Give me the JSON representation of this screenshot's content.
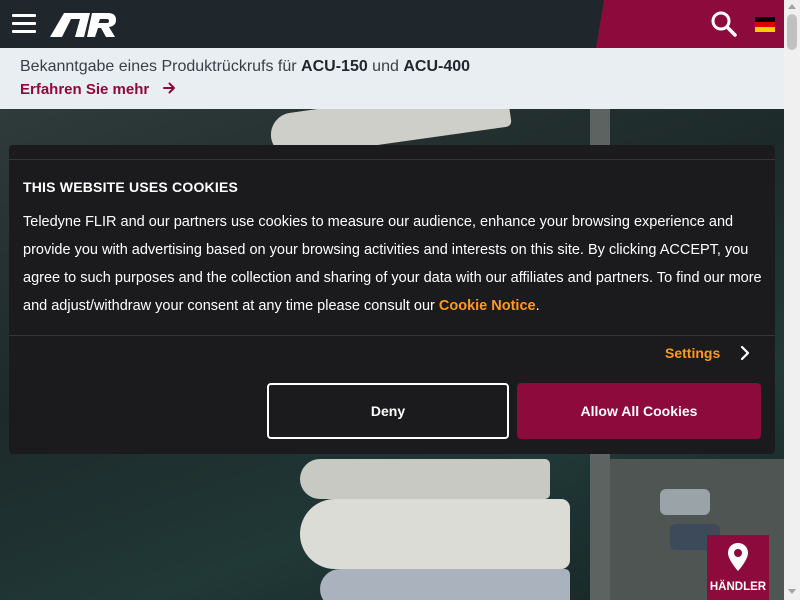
{
  "header": {
    "menu_icon": "hamburger-icon",
    "logo_icon": "brand-logo",
    "search_icon": "search-icon",
    "language_icon": "german-flag-icon",
    "colors": {
      "bar": "#1f262c",
      "accent": "#8c0a3c"
    }
  },
  "announcement": {
    "prefix": "Bekanntgabe eines Produktrückrufs für ",
    "product1": "ACU-150",
    "connector": " und ",
    "product2": "ACU-400",
    "link_label": "Erfahren Sie mehr",
    "link_icon": "arrow-right-icon"
  },
  "cookie": {
    "title": "THIS WEBSITE USES COOKIES",
    "body": "Teledyne FLIR and our partners use cookies to measure our audience, enhance your browsing experience and provide you with advertising based on your browsing activities and interests on this site. By clicking ACCEPT, you agree to such purposes and the collection and sharing of your data with our affiliates and partners. To find our more and adjust/withdraw your consent at any time please consult our ",
    "notice_link": "Cookie Notice",
    "body_end": ".",
    "settings_label": "Settings",
    "settings_icon": "chevron-right-icon",
    "deny_label": "Deny",
    "allow_label": "Allow All Cookies",
    "colors": {
      "link": "#ff9a1f",
      "primary": "#8c0a3c"
    }
  },
  "dealer": {
    "label": "HÄNDLER",
    "icon": "map-pin-icon"
  }
}
